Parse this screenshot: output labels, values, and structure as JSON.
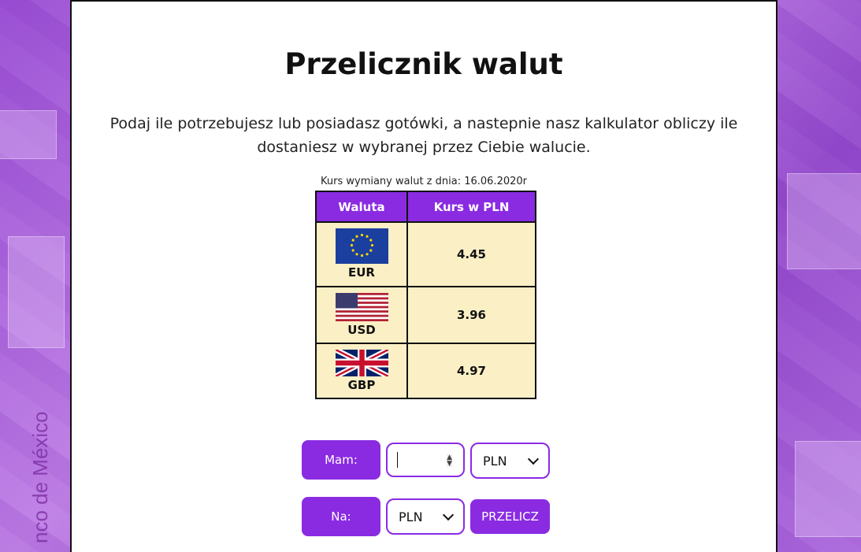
{
  "title": "Przelicznik walut",
  "intro": "Podaj ile potrzebujesz lub posiadasz gotówki, a nastepnie nasz kalkulator obliczy ile dostaniesz w wybranej przez Ciebie walucie.",
  "rate_caption": "Kurs wymiany walut z dnia: 16.06.2020r",
  "table": {
    "headers": [
      "Waluta",
      "Kurs w PLN"
    ],
    "rows": [
      {
        "code": "EUR",
        "rate": "4.45",
        "flag": "eu-flag-icon"
      },
      {
        "code": "USD",
        "rate": "3.96",
        "flag": "us-flag-icon"
      },
      {
        "code": "GBP",
        "rate": "4.97",
        "flag": "uk-flag-icon"
      }
    ]
  },
  "form": {
    "have_label": "Mam:",
    "amount_value": "",
    "have_currency": "PLN",
    "to_label": "Na:",
    "to_currency": "PLN",
    "convert_button": "PRZELICZ"
  },
  "background_text": "nco de México",
  "colors": {
    "accent": "#8a2be2",
    "table_bg": "#fbefc5"
  }
}
